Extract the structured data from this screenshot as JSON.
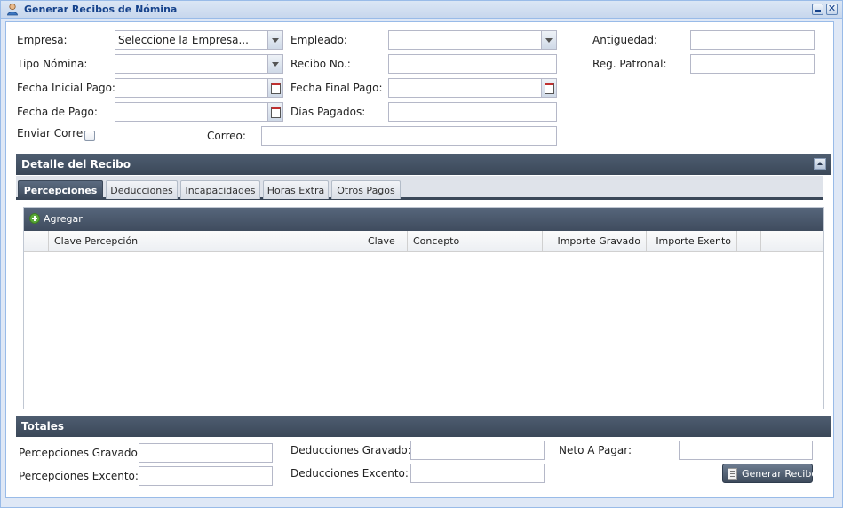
{
  "window": {
    "title": "Generar Recibos de Nómina"
  },
  "form": {
    "empresa_label": "Empresa:",
    "empresa_value": "Seleccione la Empresa...",
    "empleado_label": "Empleado:",
    "empleado_value": "",
    "antiguedad_label": "Antiguedad:",
    "antiguedad_value": "",
    "tipo_nomina_label": "Tipo Nómina:",
    "tipo_nomina_value": "",
    "recibo_no_label": "Recibo No.:",
    "recibo_no_value": "",
    "reg_patronal_label": "Reg. Patronal:",
    "reg_patronal_value": "",
    "fecha_inicial_label": "Fecha Inicial Pago:",
    "fecha_inicial_value": "",
    "fecha_final_label": "Fecha Final Pago:",
    "fecha_final_value": "",
    "fecha_pago_label": "Fecha de Pago:",
    "fecha_pago_value": "",
    "dias_pagados_label": "Días Pagados:",
    "dias_pagados_value": "",
    "enviar_correo_label": "Enviar Correo",
    "enviar_correo_checked": false,
    "correo_label": "Correo:",
    "correo_value": ""
  },
  "detalle": {
    "title": "Detalle del Recibo",
    "tabs": [
      {
        "label": "Percepciones",
        "active": true
      },
      {
        "label": "Deducciones",
        "active": false
      },
      {
        "label": "Incapacidades",
        "active": false
      },
      {
        "label": "Horas Extra",
        "active": false
      },
      {
        "label": "Otros Pagos",
        "active": false
      }
    ],
    "grid": {
      "add_label": "Agregar",
      "columns": [
        "",
        "Clave Percepción",
        "Clave",
        "Concepto",
        "Importe Gravado",
        "Importe Exento",
        ""
      ],
      "rows": []
    }
  },
  "totales": {
    "title": "Totales",
    "percepciones_gravado_label": "Percepciones Gravado:",
    "percepciones_gravado_value": "",
    "percepciones_excento_label": "Percepciones Excento:",
    "percepciones_excento_value": "",
    "deducciones_gravado_label": "Deducciones Gravado:",
    "deducciones_gravado_value": "",
    "deducciones_excento_label": "Deducciones Excento:",
    "deducciones_excento_value": "",
    "neto_label": "Neto A Pagar:",
    "neto_value": "",
    "generar_label": "Generar Recibo"
  },
  "icons": {
    "window": "user-icon",
    "add": "add-circle-icon",
    "generar": "document-icon"
  }
}
